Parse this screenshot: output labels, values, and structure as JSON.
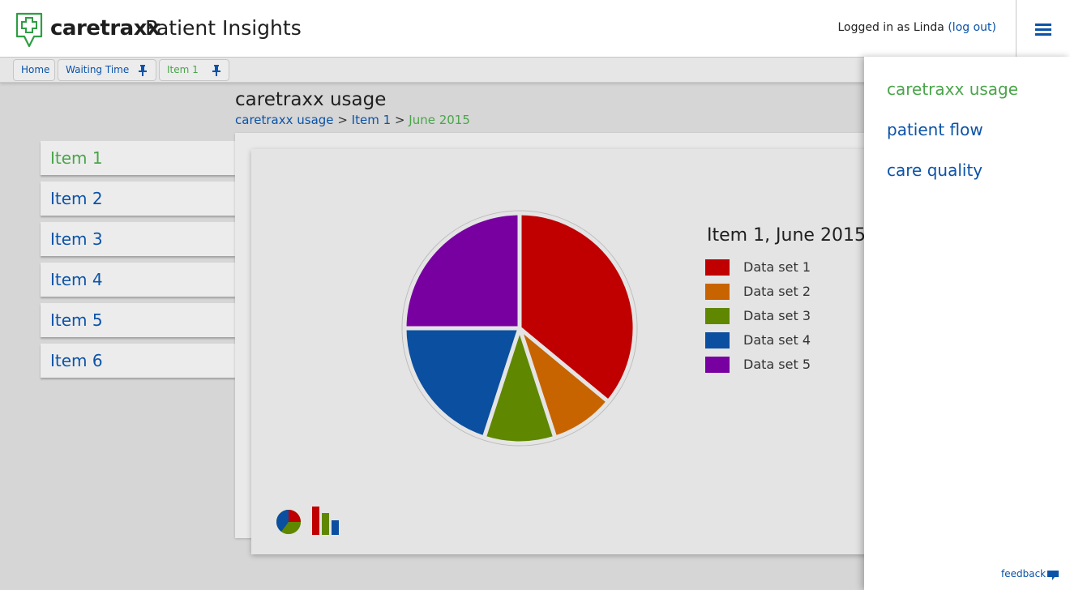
{
  "header": {
    "brand": "caretraxx",
    "product": "Patient Insights",
    "login_prefix": "Logged in as Linda",
    "logout_label": "(log out)"
  },
  "tabs": [
    {
      "label": "Home",
      "pinned": false
    },
    {
      "label": "Waiting Time",
      "pinned": true
    },
    {
      "label": "Item 1",
      "pinned": true,
      "active": true
    }
  ],
  "page": {
    "title": "caretraxx usage",
    "breadcrumb": [
      "caretraxx usage",
      "Item 1",
      "June 2015"
    ],
    "separator": ">"
  },
  "sidebar": {
    "items": [
      {
        "label": "Item 1",
        "active": true
      },
      {
        "label": "Item 2"
      },
      {
        "label": "Item 3"
      },
      {
        "label": "Item 4"
      },
      {
        "label": "Item 5"
      },
      {
        "label": "Item 6"
      }
    ]
  },
  "chart_data": {
    "type": "pie",
    "title": "Item 1,  June 2015",
    "categories": [
      "Data set 1",
      "Data set 2",
      "Data set 3",
      "Data set 4",
      "Data set 5"
    ],
    "values": [
      36,
      9,
      10,
      20,
      25
    ],
    "colors": [
      "#c00000",
      "#c86400",
      "#5f8700",
      "#0b4fa0",
      "#7800a0"
    ],
    "legend": "right"
  },
  "chart_toggles": [
    {
      "icon": "pie-chart-icon",
      "active": true
    },
    {
      "icon": "bar-chart-icon",
      "active": false
    }
  ],
  "drawer": {
    "items": [
      {
        "label": "caretraxx usage",
        "active": true
      },
      {
        "label": "patient flow"
      },
      {
        "label": "care quality"
      }
    ],
    "feedback_label": "feedback"
  },
  "colors": {
    "link": "#0b53a8",
    "active": "#4aa54a",
    "logo": "#2e9e44"
  }
}
